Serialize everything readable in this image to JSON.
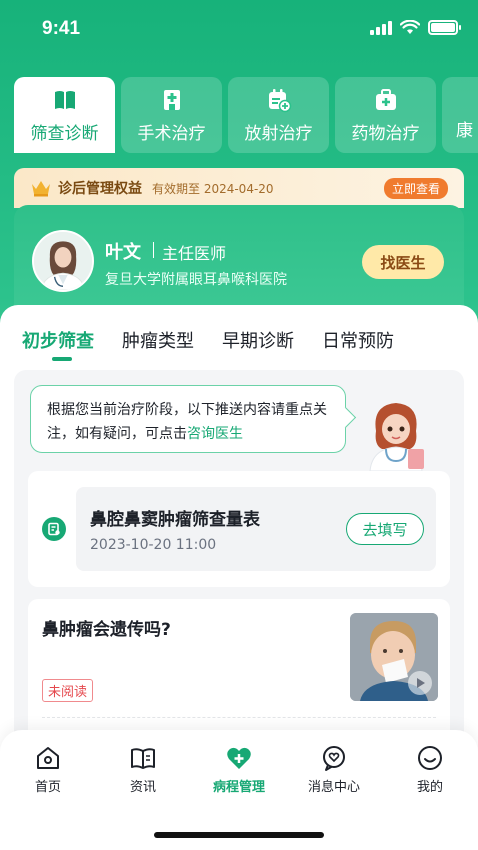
{
  "status_bar": {
    "time": "9:41"
  },
  "categories": [
    {
      "label": "筛查诊断",
      "icon": "book-icon",
      "active": true
    },
    {
      "label": "手术治疗",
      "icon": "hospital-icon",
      "active": false
    },
    {
      "label": "放射治疗",
      "icon": "calendar-add-icon",
      "active": false
    },
    {
      "label": "药物治疗",
      "icon": "medicine-box-icon",
      "active": false
    },
    {
      "label": "康",
      "icon": "",
      "active": false
    }
  ],
  "benefit": {
    "title": "诊后管理权益",
    "valid": "有效期至 2024-04-20",
    "button": "立即查看"
  },
  "doctor": {
    "name": "叶文",
    "title": "主任医师",
    "hospital": "复旦大学附属眼耳鼻喉科医院",
    "button": "找医生"
  },
  "sub_tabs": [
    {
      "label": "初步筛查",
      "active": true
    },
    {
      "label": "肿瘤类型",
      "active": false
    },
    {
      "label": "早期诊断",
      "active": false
    },
    {
      "label": "日常预防",
      "active": false
    }
  ],
  "notice": {
    "text": "根据您当前治疗阶段，以下推送内容请重点关注，如有疑问，可点击",
    "link": "咨询医生"
  },
  "form": {
    "title": "鼻腔鼻窦肿瘤筛查量表",
    "date": "2023-10-20 11:00",
    "button": "去填写"
  },
  "article": {
    "title": "鼻肿瘤会遗传吗?",
    "badge": "未阅读"
  },
  "bottom_nav": [
    {
      "label": "首页",
      "icon": "home-icon",
      "active": false
    },
    {
      "label": "资讯",
      "icon": "news-book-icon",
      "active": false
    },
    {
      "label": "病程管理",
      "icon": "heart-plus-icon",
      "active": true
    },
    {
      "label": "消息中心",
      "icon": "message-heart-icon",
      "active": false
    },
    {
      "label": "我的",
      "icon": "smile-icon",
      "active": false
    }
  ],
  "colors": {
    "primary": "#17a874",
    "accent": "#f07b2e",
    "find_button": "#ffe9a8"
  }
}
